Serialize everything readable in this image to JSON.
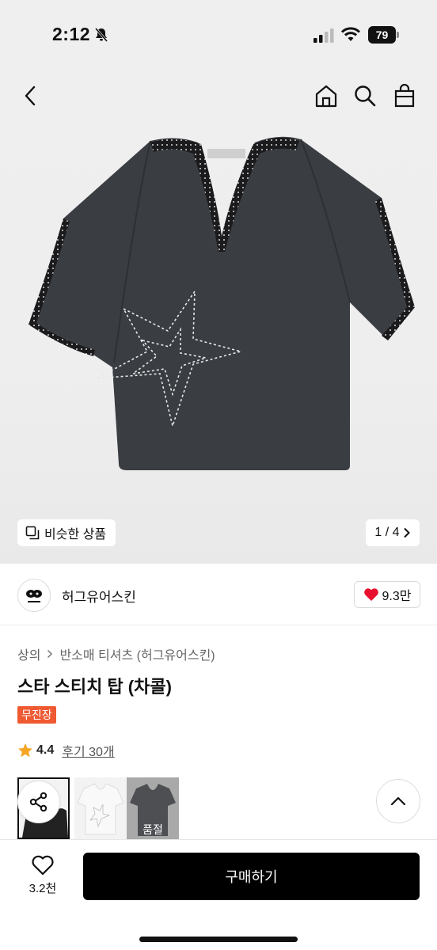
{
  "status_bar": {
    "time": "2:12",
    "battery": "79"
  },
  "gallery": {
    "similar_label": "비슷한 상품",
    "counter": "1 / 4"
  },
  "brand": {
    "name": "허그유어스킨",
    "likes": "9.3만"
  },
  "breadcrumb": {
    "category": "상의",
    "subcategory": "반소매 티셔츠 (허그유어스킨)"
  },
  "product": {
    "title": "스타 스티치 탑 (차콜)",
    "badge": "무진장",
    "rating": "4.4",
    "review_link": "후기 30개"
  },
  "thumbnails": {
    "soldout_label": "품절"
  },
  "bottom": {
    "wish_count": "3.2천",
    "buy_label": "구매하기"
  },
  "colors": {
    "badge": "#ef5a32",
    "buy_button": "#000000",
    "heart": "#e8102f",
    "star": "#f5a623"
  },
  "icons": [
    "back-icon",
    "home-icon",
    "search-icon",
    "bag-icon",
    "similar-icon",
    "chevron-right-icon",
    "heart-icon",
    "star-icon",
    "share-icon",
    "chevron-up-icon",
    "heart-outline-icon"
  ]
}
